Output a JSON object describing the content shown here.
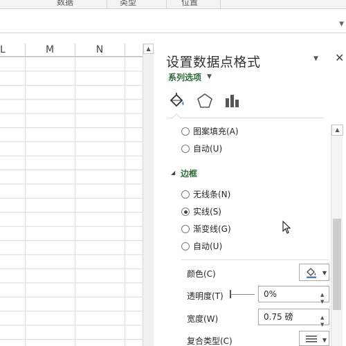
{
  "ribbon": {
    "groups": [
      "数据",
      "类型",
      "位置"
    ]
  },
  "sheet": {
    "columns": [
      "L",
      "M",
      "N"
    ]
  },
  "pane": {
    "title": "设置数据点格式",
    "series_options": "系列选项",
    "tabs": [
      {
        "name": "fill-line",
        "icon": "paint-bucket-icon"
      },
      {
        "name": "effects",
        "icon": "pentagon-icon"
      },
      {
        "name": "series-options",
        "icon": "bar-chart-icon"
      }
    ],
    "fill_options": [
      {
        "label": "图案填充(A)",
        "checked": false
      },
      {
        "label": "自动(U)",
        "checked": false
      }
    ],
    "border_section": {
      "title": "边框",
      "options": [
        {
          "label": "无线条(N)",
          "checked": false
        },
        {
          "label": "实线(S)",
          "checked": true
        },
        {
          "label": "渐变线(G)",
          "checked": false
        },
        {
          "label": "自动(U)",
          "checked": false
        }
      ],
      "color_label": "颜色(C)",
      "transparency_label": "透明度(T)",
      "transparency_value": "0%",
      "width_label": "宽度(W)",
      "width_value": "0.75 磅",
      "compound_label": "复合类型(C)"
    }
  },
  "colors": {
    "accent_green": "#2f6b3a",
    "icon_blue": "#4a7fc1"
  }
}
